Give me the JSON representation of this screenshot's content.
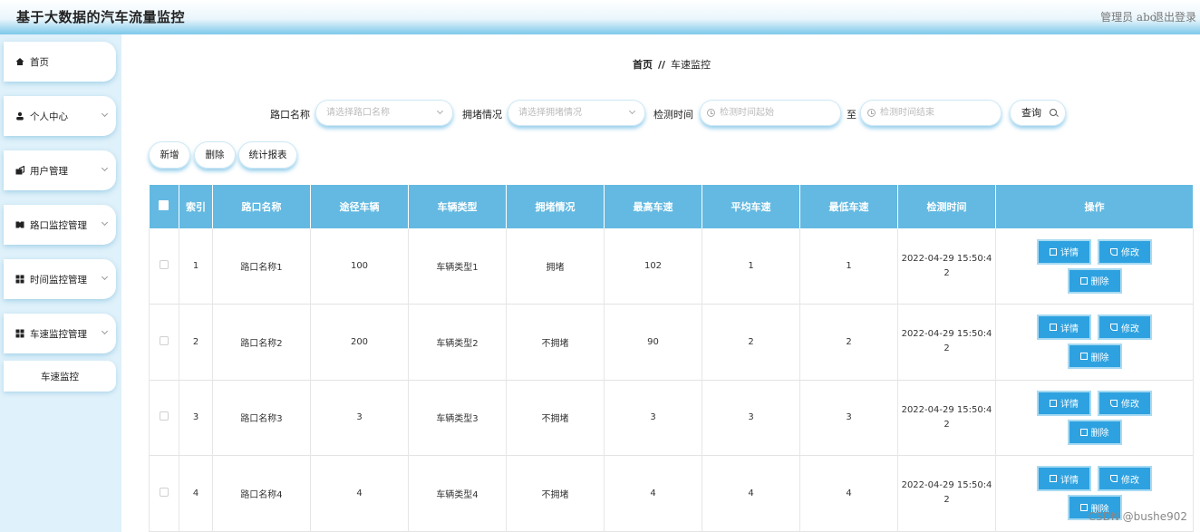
{
  "header": {
    "app_title": "基于大数据的汽车流量监控",
    "admin_text": "管理员 abo",
    "logout_label": "退出登录"
  },
  "sidebar": {
    "items": [
      {
        "label": "首页",
        "icon": "home-icon"
      },
      {
        "label": "个人中心",
        "icon": "user-icon"
      },
      {
        "label": "用户管理",
        "icon": "user-manage-icon"
      },
      {
        "label": "路口监控管理",
        "icon": "monitor-icon"
      },
      {
        "label": "时间监控管理",
        "icon": "grid-icon"
      },
      {
        "label": "车速监控管理",
        "icon": "grid-icon"
      }
    ],
    "subitem": "车速监控"
  },
  "breadcrumb": {
    "home": "首页",
    "separator": "//",
    "current": "车速监控"
  },
  "search": {
    "crossing_label": "路口名称",
    "crossing_placeholder": "请选择路口名称",
    "congestion_label": "拥堵情况",
    "congestion_placeholder": "请选择拥堵情况",
    "time_label": "检测时间",
    "time_start_placeholder": "检测时间起始",
    "to_label": "至",
    "time_end_placeholder": "检测时间结束",
    "query_label": "查询"
  },
  "toolbar": {
    "add_label": "新增",
    "delete_label": "删除",
    "report_label": "统计报表"
  },
  "table": {
    "headers": [
      "索引",
      "路口名称",
      "途径车辆",
      "车辆类型",
      "拥堵情况",
      "最高车速",
      "平均车速",
      "最低车速",
      "检测时间",
      "操作"
    ],
    "rows": [
      {
        "index": "1",
        "crossing": "路口名称1",
        "vehicles": "100",
        "type": "车辆类型1",
        "congestion": "拥堵",
        "max": "102",
        "avg": "1",
        "min": "1",
        "time1": "2022-04-29 15:50:4",
        "time2": "2"
      },
      {
        "index": "2",
        "crossing": "路口名称2",
        "vehicles": "200",
        "type": "车辆类型2",
        "congestion": "不拥堵",
        "max": "90",
        "avg": "2",
        "min": "2",
        "time1": "2022-04-29 15:50:4",
        "time2": "2"
      },
      {
        "index": "3",
        "crossing": "路口名称3",
        "vehicles": "3",
        "type": "车辆类型3",
        "congestion": "不拥堵",
        "max": "3",
        "avg": "3",
        "min": "3",
        "time1": "2022-04-29 15:50:4",
        "time2": "2"
      },
      {
        "index": "4",
        "crossing": "路口名称4",
        "vehicles": "4",
        "type": "车辆类型4",
        "congestion": "不拥堵",
        "max": "4",
        "avg": "4",
        "min": "4",
        "time1": "2022-04-29 15:50:4",
        "time2": "2"
      }
    ],
    "ops": {
      "detail_label": "详情",
      "edit_label": "修改",
      "delete_label": "删除"
    }
  },
  "watermark": "CSDN @bushe902",
  "colors": {
    "accent": "#63b9e1",
    "button_blue": "#2ea2e0",
    "sidebar_bg": "#dff1fa"
  }
}
